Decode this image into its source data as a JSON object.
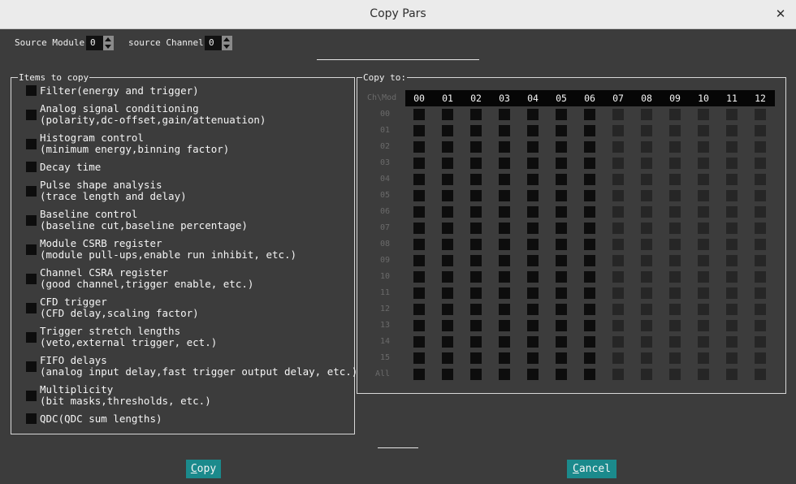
{
  "window": {
    "title": "Copy Pars"
  },
  "source": {
    "module_label": "Source Module:",
    "module_value": "0",
    "channel_label": "source Channel:",
    "channel_value": "0"
  },
  "items_frame": {
    "title": "Items to copy",
    "items": [
      {
        "line1": "Filter(energy and trigger)",
        "line2": ""
      },
      {
        "line1": "Analog signal conditioning",
        "line2": "(polarity,dc-offset,gain/attenuation)"
      },
      {
        "line1": "Histogram control",
        "line2": "(minimum energy,binning factor)"
      },
      {
        "line1": "Decay time",
        "line2": ""
      },
      {
        "line1": "Pulse shape analysis",
        "line2": "(trace length and delay)"
      },
      {
        "line1": "Baseline control",
        "line2": "(baseline cut,baseline percentage)"
      },
      {
        "line1": "Module CSRB register",
        "line2": "(module pull-ups,enable run inhibit, etc.)"
      },
      {
        "line1": "Channel CSRA register",
        "line2": "(good channel,trigger enable, etc.)"
      },
      {
        "line1": "CFD trigger",
        "line2": "(CFD delay,scaling factor)"
      },
      {
        "line1": "Trigger stretch lengths",
        "line2": "(veto,external trigger, ect.)"
      },
      {
        "line1": "FIFO delays",
        "line2": "(analog input delay,fast trigger output delay, etc.)"
      },
      {
        "line1": "Multiplicity",
        "line2": "(bit masks,thresholds, etc.)"
      },
      {
        "line1": "QDC(QDC sum lengths)",
        "line2": ""
      }
    ]
  },
  "copy_to": {
    "title": "Copy to:",
    "corner_label": "Ch\\Mod",
    "modules": [
      "00",
      "01",
      "02",
      "03",
      "04",
      "05",
      "06",
      "07",
      "08",
      "09",
      "10",
      "11",
      "12"
    ],
    "channels": [
      "00",
      "01",
      "02",
      "03",
      "04",
      "05",
      "06",
      "07",
      "08",
      "09",
      "10",
      "11",
      "12",
      "13",
      "14",
      "15",
      "All"
    ],
    "active_module_count": 7
  },
  "buttons": {
    "copy": {
      "accel": "C",
      "rest": "opy"
    },
    "cancel": {
      "accel": "C",
      "rest": "ancel"
    }
  },
  "colors": {
    "accent": "#1b8a8c",
    "checkbox": "#0d0d0d",
    "checkbox_inactive": "#262626",
    "background": "#3c3c3c"
  }
}
